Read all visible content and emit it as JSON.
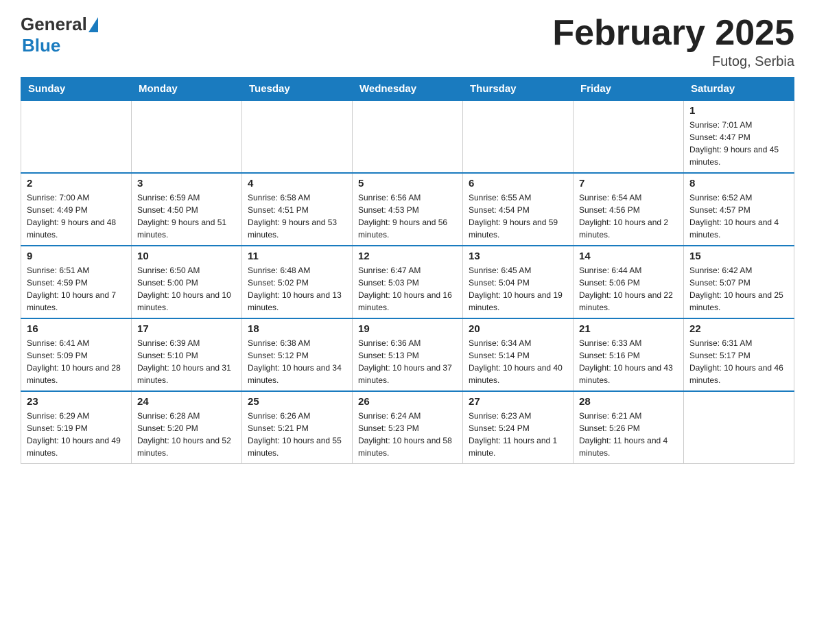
{
  "header": {
    "logo_general": "General",
    "logo_blue": "Blue",
    "month_title": "February 2025",
    "location": "Futog, Serbia"
  },
  "weekdays": [
    "Sunday",
    "Monday",
    "Tuesday",
    "Wednesday",
    "Thursday",
    "Friday",
    "Saturday"
  ],
  "weeks": [
    [
      {
        "day": "",
        "info": ""
      },
      {
        "day": "",
        "info": ""
      },
      {
        "day": "",
        "info": ""
      },
      {
        "day": "",
        "info": ""
      },
      {
        "day": "",
        "info": ""
      },
      {
        "day": "",
        "info": ""
      },
      {
        "day": "1",
        "info": "Sunrise: 7:01 AM\nSunset: 4:47 PM\nDaylight: 9 hours and 45 minutes."
      }
    ],
    [
      {
        "day": "2",
        "info": "Sunrise: 7:00 AM\nSunset: 4:49 PM\nDaylight: 9 hours and 48 minutes."
      },
      {
        "day": "3",
        "info": "Sunrise: 6:59 AM\nSunset: 4:50 PM\nDaylight: 9 hours and 51 minutes."
      },
      {
        "day": "4",
        "info": "Sunrise: 6:58 AM\nSunset: 4:51 PM\nDaylight: 9 hours and 53 minutes."
      },
      {
        "day": "5",
        "info": "Sunrise: 6:56 AM\nSunset: 4:53 PM\nDaylight: 9 hours and 56 minutes."
      },
      {
        "day": "6",
        "info": "Sunrise: 6:55 AM\nSunset: 4:54 PM\nDaylight: 9 hours and 59 minutes."
      },
      {
        "day": "7",
        "info": "Sunrise: 6:54 AM\nSunset: 4:56 PM\nDaylight: 10 hours and 2 minutes."
      },
      {
        "day": "8",
        "info": "Sunrise: 6:52 AM\nSunset: 4:57 PM\nDaylight: 10 hours and 4 minutes."
      }
    ],
    [
      {
        "day": "9",
        "info": "Sunrise: 6:51 AM\nSunset: 4:59 PM\nDaylight: 10 hours and 7 minutes."
      },
      {
        "day": "10",
        "info": "Sunrise: 6:50 AM\nSunset: 5:00 PM\nDaylight: 10 hours and 10 minutes."
      },
      {
        "day": "11",
        "info": "Sunrise: 6:48 AM\nSunset: 5:02 PM\nDaylight: 10 hours and 13 minutes."
      },
      {
        "day": "12",
        "info": "Sunrise: 6:47 AM\nSunset: 5:03 PM\nDaylight: 10 hours and 16 minutes."
      },
      {
        "day": "13",
        "info": "Sunrise: 6:45 AM\nSunset: 5:04 PM\nDaylight: 10 hours and 19 minutes."
      },
      {
        "day": "14",
        "info": "Sunrise: 6:44 AM\nSunset: 5:06 PM\nDaylight: 10 hours and 22 minutes."
      },
      {
        "day": "15",
        "info": "Sunrise: 6:42 AM\nSunset: 5:07 PM\nDaylight: 10 hours and 25 minutes."
      }
    ],
    [
      {
        "day": "16",
        "info": "Sunrise: 6:41 AM\nSunset: 5:09 PM\nDaylight: 10 hours and 28 minutes."
      },
      {
        "day": "17",
        "info": "Sunrise: 6:39 AM\nSunset: 5:10 PM\nDaylight: 10 hours and 31 minutes."
      },
      {
        "day": "18",
        "info": "Sunrise: 6:38 AM\nSunset: 5:12 PM\nDaylight: 10 hours and 34 minutes."
      },
      {
        "day": "19",
        "info": "Sunrise: 6:36 AM\nSunset: 5:13 PM\nDaylight: 10 hours and 37 minutes."
      },
      {
        "day": "20",
        "info": "Sunrise: 6:34 AM\nSunset: 5:14 PM\nDaylight: 10 hours and 40 minutes."
      },
      {
        "day": "21",
        "info": "Sunrise: 6:33 AM\nSunset: 5:16 PM\nDaylight: 10 hours and 43 minutes."
      },
      {
        "day": "22",
        "info": "Sunrise: 6:31 AM\nSunset: 5:17 PM\nDaylight: 10 hours and 46 minutes."
      }
    ],
    [
      {
        "day": "23",
        "info": "Sunrise: 6:29 AM\nSunset: 5:19 PM\nDaylight: 10 hours and 49 minutes."
      },
      {
        "day": "24",
        "info": "Sunrise: 6:28 AM\nSunset: 5:20 PM\nDaylight: 10 hours and 52 minutes."
      },
      {
        "day": "25",
        "info": "Sunrise: 6:26 AM\nSunset: 5:21 PM\nDaylight: 10 hours and 55 minutes."
      },
      {
        "day": "26",
        "info": "Sunrise: 6:24 AM\nSunset: 5:23 PM\nDaylight: 10 hours and 58 minutes."
      },
      {
        "day": "27",
        "info": "Sunrise: 6:23 AM\nSunset: 5:24 PM\nDaylight: 11 hours and 1 minute."
      },
      {
        "day": "28",
        "info": "Sunrise: 6:21 AM\nSunset: 5:26 PM\nDaylight: 11 hours and 4 minutes."
      },
      {
        "day": "",
        "info": ""
      }
    ]
  ]
}
